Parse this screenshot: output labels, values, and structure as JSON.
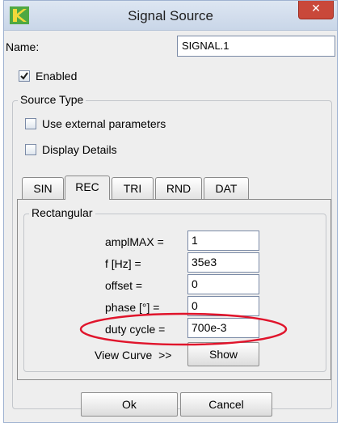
{
  "window": {
    "title": "Signal Source",
    "close_glyph": "✕",
    "app_icon": "yellow-green-arrow-icon"
  },
  "name_field": {
    "label": "Name:",
    "value": "SIGNAL.1"
  },
  "enabled": {
    "label": "Enabled",
    "checked": true
  },
  "source_type": {
    "title": "Source Type",
    "use_external": {
      "label": "Use external parameters",
      "checked": false
    },
    "display_details": {
      "label": "Display Details",
      "checked": false
    }
  },
  "tabs": [
    {
      "label": "SIN",
      "active": false
    },
    {
      "label": "REC",
      "active": true
    },
    {
      "label": "TRI",
      "active": false
    },
    {
      "label": "RND",
      "active": false
    },
    {
      "label": "DAT",
      "active": false
    }
  ],
  "rectangular": {
    "title": "Rectangular",
    "params": [
      {
        "label": "amplMAX =",
        "value": "1"
      },
      {
        "label": "f [Hz] =",
        "value": "35e3"
      },
      {
        "label": "offset =",
        "value": "0"
      },
      {
        "label": "phase [°] =",
        "value": "0"
      },
      {
        "label": "duty cycle =",
        "value": "700e-3"
      }
    ],
    "view_curve_label": "View Curve  >>",
    "show_button": "Show"
  },
  "buttons": {
    "ok": "Ok",
    "cancel": "Cancel"
  },
  "colors": {
    "highlight": "#e0142b",
    "title_bar": "#d4deec",
    "close_button": "#c9483a"
  }
}
